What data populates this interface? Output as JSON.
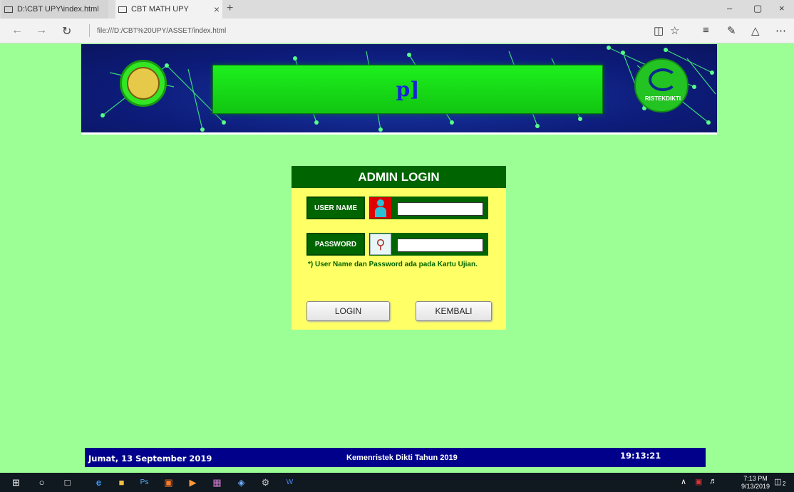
{
  "browser": {
    "tabs": [
      {
        "label": "D:\\CBT UPY\\index.html",
        "active": false
      },
      {
        "label": "CBT MATH UPY",
        "active": true
      }
    ],
    "new_tab_icon": "+",
    "close_tab_icon": "×",
    "url": "file:///D:/CBT%20UPY/ASSET/index.html",
    "window_controls": [
      "–",
      "▢",
      "×"
    ]
  },
  "banner": {
    "title": "p]",
    "left_logo": "university-seal",
    "right_logo_text": "RISTEKDIKTI"
  },
  "login": {
    "heading": "ADMIN LOGIN",
    "username_label": "USER NAME",
    "username_value": "",
    "password_label": "PASSWORD",
    "password_value": "",
    "note": "*)  User Name dan Password ada pada Kartu Ujian.",
    "login_button": "LOGIN",
    "back_button": "KEMBALI"
  },
  "footer": {
    "date": "Jumat, 13 September 2019",
    "center": "Kemenristek Dikti Tahun 2019",
    "time": "19:13:21"
  },
  "taskbar": {
    "clock_time": "7:13 PM",
    "clock_date": "9/13/2019",
    "notification_count": "2"
  },
  "colors": {
    "page_bg": "#9bff96",
    "login_bg": "#ffff66",
    "header_green": "#006400",
    "footer_blue": "#00008b"
  }
}
